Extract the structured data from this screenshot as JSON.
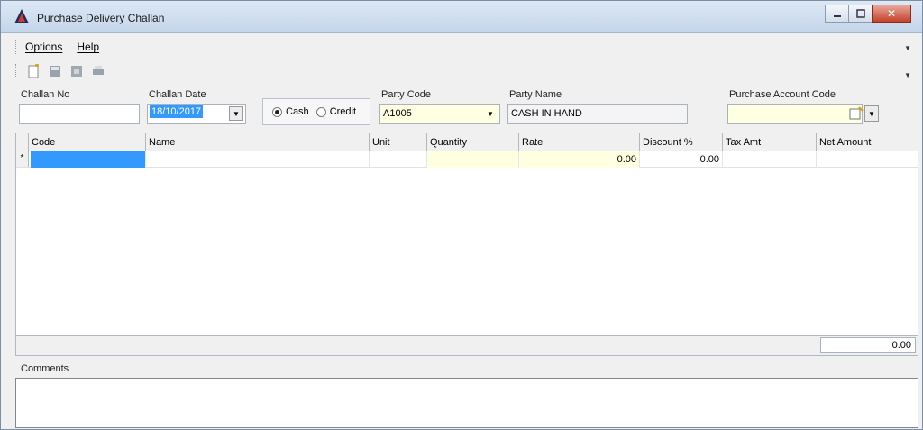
{
  "window": {
    "title": "Purchase Delivery Challan"
  },
  "menu": {
    "items": [
      "Options",
      "Help"
    ]
  },
  "toolbar": {
    "icons": [
      "new-icon",
      "save-icon",
      "delete-icon",
      "print-icon"
    ]
  },
  "header": {
    "challan_no": {
      "label": "Challan No",
      "value": ""
    },
    "challan_date": {
      "label": "Challan Date",
      "value": "18/10/2017"
    },
    "payment": {
      "cash_label": "Cash",
      "credit_label": "Credit",
      "selected": "Cash"
    },
    "party_code": {
      "label": "Party Code",
      "value": "A1005"
    },
    "party_name": {
      "label": "Party Name",
      "value": "CASH IN HAND"
    },
    "purchase_account_code": {
      "label": "Purchase Account Code",
      "value": ""
    }
  },
  "grid": {
    "columns": [
      "Code",
      "Name",
      "Unit",
      "Quantity",
      "Rate",
      "Discount %",
      "Tax Amt",
      "Net Amount"
    ],
    "row_marker": "*",
    "rows": [
      {
        "code": "",
        "name": "",
        "unit": "",
        "quantity": "",
        "rate": "0.00",
        "discount": "0.00",
        "tax_amt": "",
        "net_amount": ""
      }
    ]
  },
  "totals": {
    "net_total": "0.00"
  },
  "comments": {
    "label": "Comments",
    "value": ""
  },
  "colors": {
    "selection": "#3399ff",
    "required_field": "#ffffe1",
    "title_gradient": "#c4d5ea"
  }
}
